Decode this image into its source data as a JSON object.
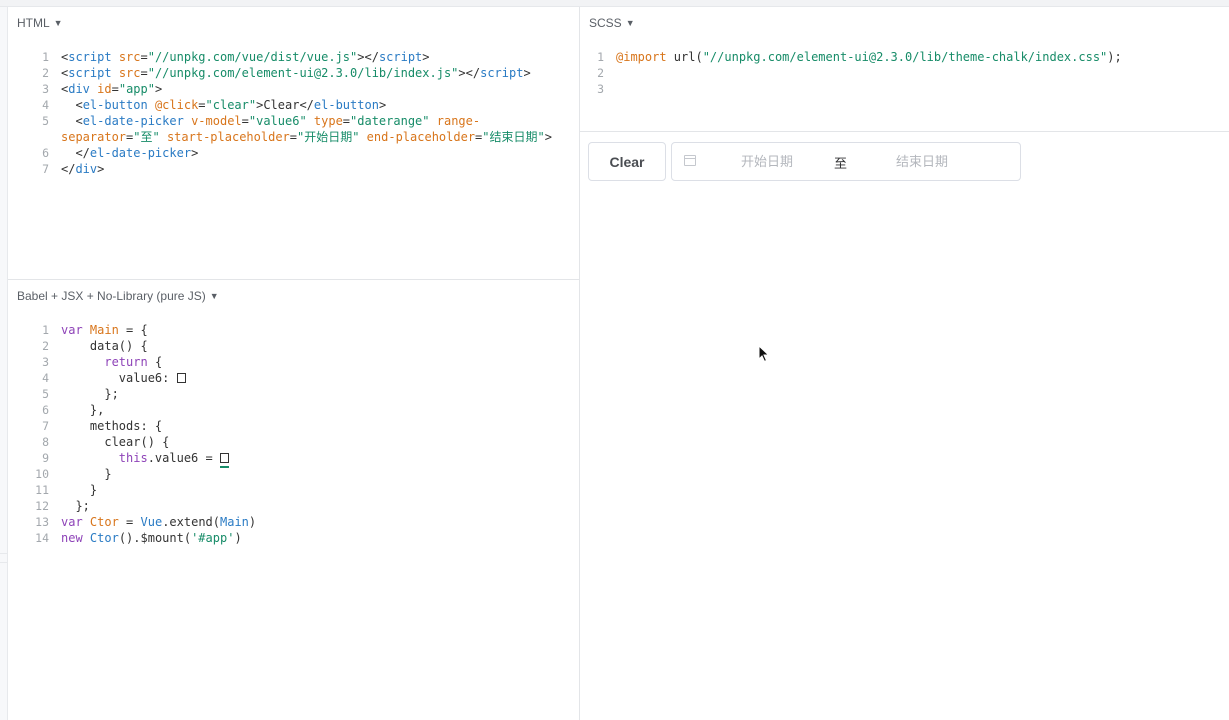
{
  "panes": {
    "html_label": "HTML",
    "js_label": "Babel + JSX + No-Library (pure JS)",
    "css_label": "SCSS"
  },
  "html_code": {
    "line_numbers": [
      "1",
      "2",
      "3",
      "4",
      "5",
      "",
      "6",
      "7"
    ],
    "l1": {
      "a": "<",
      "b": "script",
      "c": " src",
      "d": "=",
      "e": "\"//unpkg.com/vue/dist/vue.js\"",
      "f": "></",
      "g": "script",
      "h": ">"
    },
    "l2": {
      "a": "<",
      "b": "script",
      "c": " src",
      "d": "=",
      "e": "\"//unpkg.com/element-ui@2.3.0/lib/index.js\"",
      "f": "></",
      "g": "script",
      "h": ">"
    },
    "l3": {
      "a": "<",
      "b": "div",
      "c": " id",
      "d": "=",
      "e": "\"app\"",
      "f": ">"
    },
    "l4": {
      "a": "  <",
      "b": "el-button",
      "c": " @click",
      "d": "=",
      "e": "\"clear\"",
      "f": ">Clear</",
      "g": "el-button",
      "h": ">"
    },
    "l5": {
      "a": "  <",
      "b": "el-date-picker",
      "c": " v-model",
      "d": "=",
      "e": "\"value6\"",
      "f": " type",
      "g": "=",
      "h": "\"daterange\"",
      "i": " range-"
    },
    "l5b": {
      "a": "separator",
      "b": "=",
      "c": "\"至\"",
      "d": " start-placeholder",
      "e": "=",
      "f": "\"开始日期\"",
      "g": " end-placeholder",
      "h": "=",
      "i": "\"结束日期\"",
      "j": ">"
    },
    "l6": {
      "a": "  </",
      "b": "el-date-picker",
      "c": ">"
    },
    "l7": {
      "a": "</",
      "b": "div",
      "c": ">"
    }
  },
  "css_code": {
    "line_numbers": [
      "1",
      "2",
      "3"
    ],
    "l1": {
      "a": "@import",
      "b": " url(",
      "c": "\"//unpkg.com/element-ui@2.3.0/lib/theme-chalk/index.css\"",
      "d": ");"
    }
  },
  "js_code": {
    "line_numbers": [
      "1",
      "2",
      "3",
      "4",
      "5",
      "6",
      "7",
      "8",
      "9",
      "10",
      "11",
      "12",
      "13",
      "14"
    ],
    "l1": {
      "a": "var",
      "b": " ",
      "c": "Main",
      "d": " = {"
    },
    "l2": "    data() {",
    "l3": {
      "a": "      ",
      "b": "return",
      "c": " {"
    },
    "l4": "        value6: ",
    "l5": "      };",
    "l6": "    },",
    "l7": "    methods: {",
    "l8": "      clear() {",
    "l9": {
      "a": "        ",
      "b": "this",
      "c": ".value6 = "
    },
    "l10": "      }",
    "l11": "    }",
    "l12": "  };",
    "l13": {
      "a": "var",
      "b": " ",
      "c": "Ctor",
      "d": " = ",
      "e": "Vue",
      "f": ".extend(",
      "g": "Main",
      "h": ")"
    },
    "l14": {
      "a": "new",
      "b": " ",
      "c": "Ctor",
      "d": "().$mount(",
      "e": "'#app'",
      "f": ")"
    }
  },
  "result": {
    "clear_button": "Clear",
    "start_placeholder": "开始日期",
    "separator": "至",
    "end_placeholder": "结束日期"
  }
}
